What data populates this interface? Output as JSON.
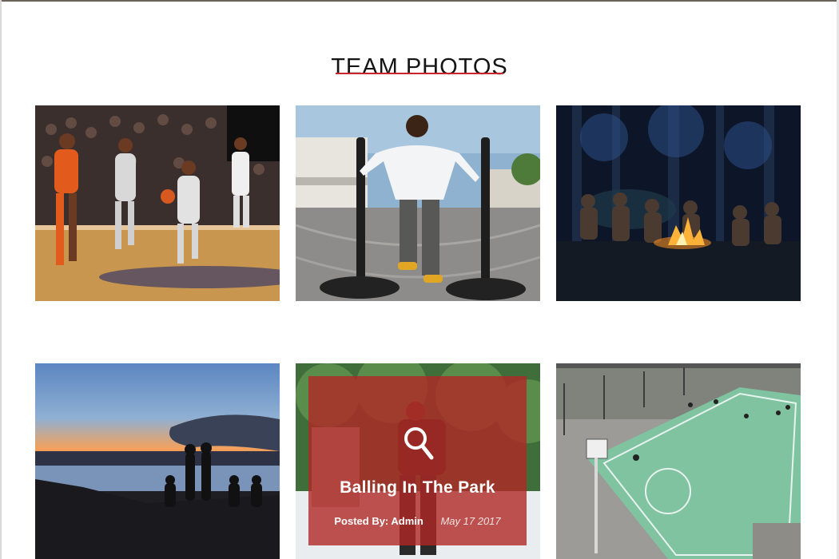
{
  "section": {
    "title": "TEAM PHOTOS"
  },
  "gallery": {
    "items": [
      {
        "scene": "basketball-game"
      },
      {
        "scene": "sled-push-training"
      },
      {
        "scene": "campfire-night"
      },
      {
        "scene": "lake-sunset-silhouettes"
      },
      {
        "scene": "park-basketball",
        "hover": {
          "title": "Balling In The Park",
          "posted_by": "Posted By: Admin",
          "date": "May 17 2017",
          "icon": "magnifier-icon"
        }
      },
      {
        "scene": "aerial-court"
      }
    ]
  },
  "colors": {
    "accent": "#c8262b",
    "overlay": "#b02826",
    "title": "#151515"
  }
}
